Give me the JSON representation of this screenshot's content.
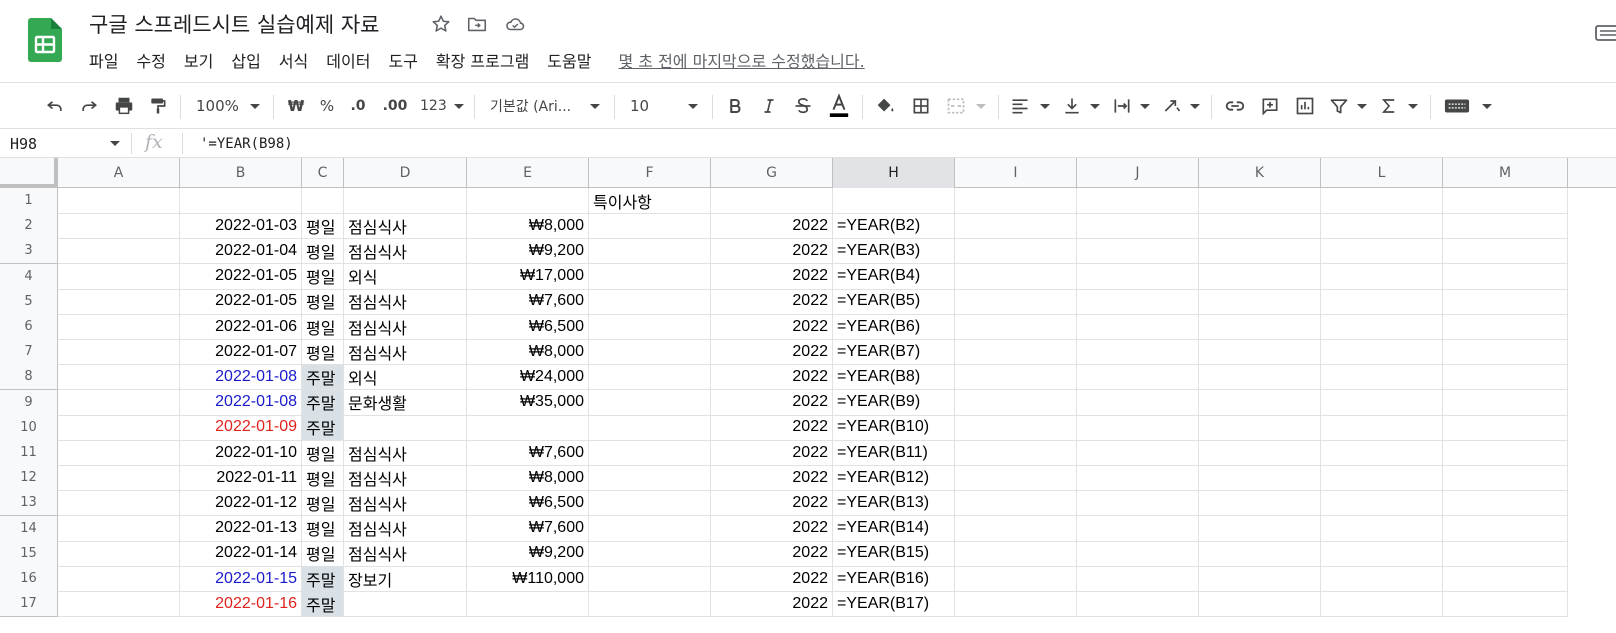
{
  "header": {
    "title": "구글 스프레드시트 실습예제 자료",
    "menu": [
      "파일",
      "수정",
      "보기",
      "삽입",
      "서식",
      "데이터",
      "도구",
      "확장 프로그램",
      "도움말"
    ],
    "last_edit": "몇 초 전에 마지막으로 수정했습니다."
  },
  "toolbar": {
    "zoom": "100%",
    "currency": "₩",
    "percent": "%",
    "decrease_decimal": ".0",
    "increase_decimal": ".00",
    "number_format": "123",
    "font": "기본값 (Ari...",
    "font_size": "10",
    "text_color": "#000000"
  },
  "formula_bar": {
    "name_box": "H98",
    "fx": "fx",
    "formula": "'=YEAR(B98)"
  },
  "grid": {
    "columns": [
      "A",
      "B",
      "C",
      "D",
      "E",
      "F",
      "G",
      "H",
      "I",
      "J",
      "K",
      "L",
      "M"
    ],
    "selected_column": "H",
    "weekend_fill": "#d9e1e6",
    "date_colors": {
      "normal": "#000000",
      "saturday": "#1a1acd",
      "sunday": "#e0231c"
    },
    "rows": [
      {
        "num": "1",
        "b": "",
        "c": "",
        "d": "",
        "e": "",
        "f": "특이사항",
        "g": "",
        "h": "",
        "day": ""
      },
      {
        "num": "2",
        "b": "2022-01-03",
        "c": "평일",
        "d": "점심식사",
        "e": "₩8,000",
        "f": "",
        "g": "2022",
        "h": "=YEAR(B2)",
        "day": "weekday"
      },
      {
        "num": "3",
        "b": "2022-01-04",
        "c": "평일",
        "d": "점심식사",
        "e": "₩9,200",
        "f": "",
        "g": "2022",
        "h": "=YEAR(B3)",
        "day": "weekday"
      },
      {
        "num": "4",
        "b": "2022-01-05",
        "c": "평일",
        "d": "외식",
        "e": "₩17,000",
        "f": "",
        "g": "2022",
        "h": "=YEAR(B4)",
        "day": "weekday"
      },
      {
        "num": "5",
        "b": "2022-01-05",
        "c": "평일",
        "d": "점심식사",
        "e": "₩7,600",
        "f": "",
        "g": "2022",
        "h": "=YEAR(B5)",
        "day": "weekday"
      },
      {
        "num": "6",
        "b": "2022-01-06",
        "c": "평일",
        "d": "점심식사",
        "e": "₩6,500",
        "f": "",
        "g": "2022",
        "h": "=YEAR(B6)",
        "day": "weekday"
      },
      {
        "num": "7",
        "b": "2022-01-07",
        "c": "평일",
        "d": "점심식사",
        "e": "₩8,000",
        "f": "",
        "g": "2022",
        "h": "=YEAR(B7)",
        "day": "weekday"
      },
      {
        "num": "8",
        "b": "2022-01-08",
        "c": "주말",
        "d": "외식",
        "e": "₩24,000",
        "f": "",
        "g": "2022",
        "h": "=YEAR(B8)",
        "day": "saturday"
      },
      {
        "num": "9",
        "b": "2022-01-08",
        "c": "주말",
        "d": "문화생활",
        "e": "₩35,000",
        "f": "",
        "g": "2022",
        "h": "=YEAR(B9)",
        "day": "saturday"
      },
      {
        "num": "10",
        "b": "2022-01-09",
        "c": "주말",
        "d": "",
        "e": "",
        "f": "",
        "g": "2022",
        "h": "=YEAR(B10)",
        "day": "sunday"
      },
      {
        "num": "11",
        "b": "2022-01-10",
        "c": "평일",
        "d": "점심식사",
        "e": "₩7,600",
        "f": "",
        "g": "2022",
        "h": "=YEAR(B11)",
        "day": "weekday"
      },
      {
        "num": "12",
        "b": "2022-01-11",
        "c": "평일",
        "d": "점심식사",
        "e": "₩8,000",
        "f": "",
        "g": "2022",
        "h": "=YEAR(B12)",
        "day": "weekday"
      },
      {
        "num": "13",
        "b": "2022-01-12",
        "c": "평일",
        "d": "점심식사",
        "e": "₩6,500",
        "f": "",
        "g": "2022",
        "h": "=YEAR(B13)",
        "day": "weekday"
      },
      {
        "num": "14",
        "b": "2022-01-13",
        "c": "평일",
        "d": "점심식사",
        "e": "₩7,600",
        "f": "",
        "g": "2022",
        "h": "=YEAR(B14)",
        "day": "weekday"
      },
      {
        "num": "15",
        "b": "2022-01-14",
        "c": "평일",
        "d": "점심식사",
        "e": "₩9,200",
        "f": "",
        "g": "2022",
        "h": "=YEAR(B15)",
        "day": "weekday"
      },
      {
        "num": "16",
        "b": "2022-01-15",
        "c": "주말",
        "d": "장보기",
        "e": "₩110,000",
        "f": "",
        "g": "2022",
        "h": "=YEAR(B16)",
        "day": "saturday"
      },
      {
        "num": "17",
        "b": "2022-01-16",
        "c": "주말",
        "d": "",
        "e": "",
        "f": "",
        "g": "2022",
        "h": "=YEAR(B17)",
        "day": "sunday"
      }
    ]
  }
}
